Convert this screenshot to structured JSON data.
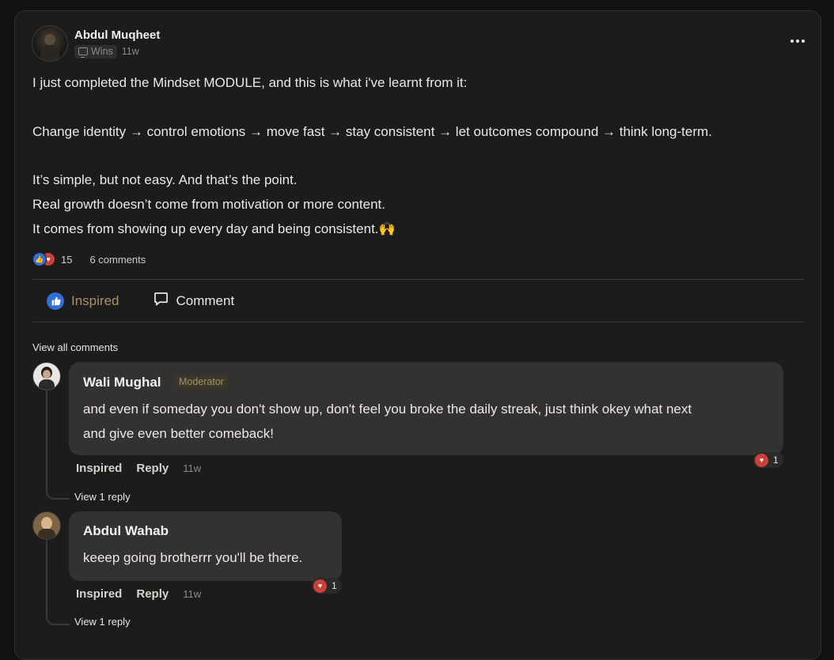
{
  "post": {
    "author": "Abdul Muqheet",
    "category": "Wins",
    "time": "11w",
    "lines": [
      "I just completed the Mindset MODULE, and this is what i've learnt from it:",
      "Change identity → control emotions → move fast → stay consistent → let outcomes compound → think long-term.",
      "It’s simple, but not easy. And that’s the point.",
      "Real growth doesn’t come from motivation or more content.",
      "It comes from showing up every day and being consistent.🙌"
    ],
    "reaction_count": "15",
    "comments_count_label": "6 comments"
  },
  "actions": {
    "inspired": "Inspired",
    "comment": "Comment"
  },
  "view_all_comments": "View all comments",
  "comments": [
    {
      "author": "Wali Mughal",
      "badge": "Moderator",
      "text_lines": [
        "and even if someday you don't show up, don't feel you broke the daily streak, just think okey what next",
        "and give even better comeback!"
      ],
      "inspired": "Inspired",
      "reply": "Reply",
      "time": "11w",
      "love_count": "1",
      "view_replies": "View 1 reply"
    },
    {
      "author": "Abdul Wahab",
      "text_lines": [
        "keeep going brotherrr you'll be there."
      ],
      "inspired": "Inspired",
      "reply": "Reply",
      "time": "11w",
      "love_count": "1",
      "view_replies": "View 1 reply"
    }
  ],
  "colors": {
    "background": "#121212",
    "card": "#1c1c1c",
    "accent_gold": "#a8906a",
    "like_blue": "#2f6fd6",
    "love_red": "#c9413a"
  },
  "icons": [
    "monitor-icon",
    "more-icon",
    "like-icon",
    "love-icon",
    "comment-bubble-icon"
  ]
}
